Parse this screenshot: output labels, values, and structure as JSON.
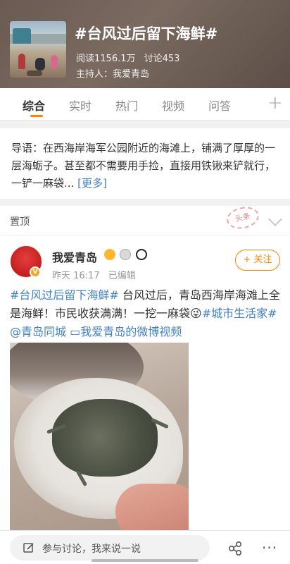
{
  "header": {
    "title": "#台风过后留下海鲜#",
    "read_label": "阅读1156.1万",
    "discuss_label": "讨论453",
    "host_label": "主持人：我爱青岛"
  },
  "tabs": [
    {
      "label": "综合",
      "active": true
    },
    {
      "label": "实时",
      "active": false
    },
    {
      "label": "热门",
      "active": false
    },
    {
      "label": "视频",
      "active": false
    },
    {
      "label": "问答",
      "active": false
    }
  ],
  "intro": {
    "text": "导语：在西海岸海军公园附近的海滩上，铺满了厚厚的一层海蛎子。甚至都不需要用手捡，直接用铁锹来铲就行，一铲一麻袋...",
    "more": "[更多]"
  },
  "pinned": {
    "label": "置顶",
    "stamp": "头条"
  },
  "post": {
    "username": "我爱青岛",
    "time": "昨天 16:17",
    "edited": "已编辑",
    "follow_label": "+ 关注",
    "hashtag1": "#台风过后留下海鲜#",
    "body1": "台风过后，青岛西海岸海滩上全是海鲜！市民收获满满！一挖一麻袋",
    "emoji": "😜",
    "hashtag2": "#城市生活家#",
    "mention": "@青岛同城",
    "video_link": "我爱青岛的微博视频",
    "video_icon_glyph": "▭"
  },
  "bottom_bar": {
    "comment_placeholder": "参与讨论，我来说一说",
    "more_glyph": "···"
  },
  "colors": {
    "accent": "#ff8200",
    "link": "#3f7fc9"
  }
}
